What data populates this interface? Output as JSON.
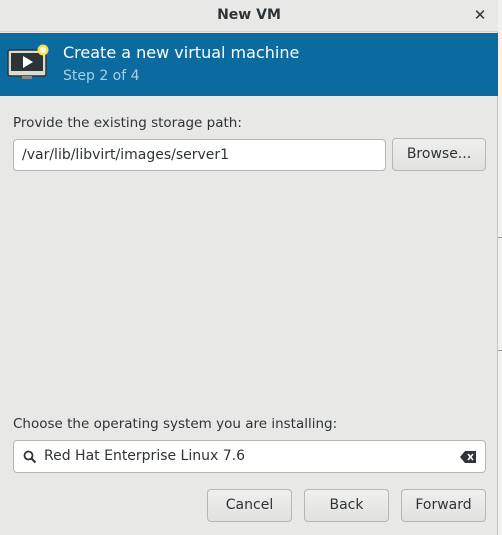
{
  "window": {
    "title": "New VM"
  },
  "header": {
    "title": "Create a new virtual machine",
    "step": "Step 2 of 4",
    "icon": "vm-monitor-icon"
  },
  "storage": {
    "label": "Provide the existing storage path:",
    "path": "/var/lib/libvirt/images/server1",
    "browse_label": "Browse..."
  },
  "os": {
    "label": "Choose the operating system you are installing:",
    "value": "Red Hat Enterprise Linux 7.6"
  },
  "footer": {
    "cancel_label": "Cancel",
    "back_label": "Back",
    "forward_label": "Forward"
  },
  "colors": {
    "banner": "#0c6b9e",
    "window_bg": "#e8e8e7"
  }
}
